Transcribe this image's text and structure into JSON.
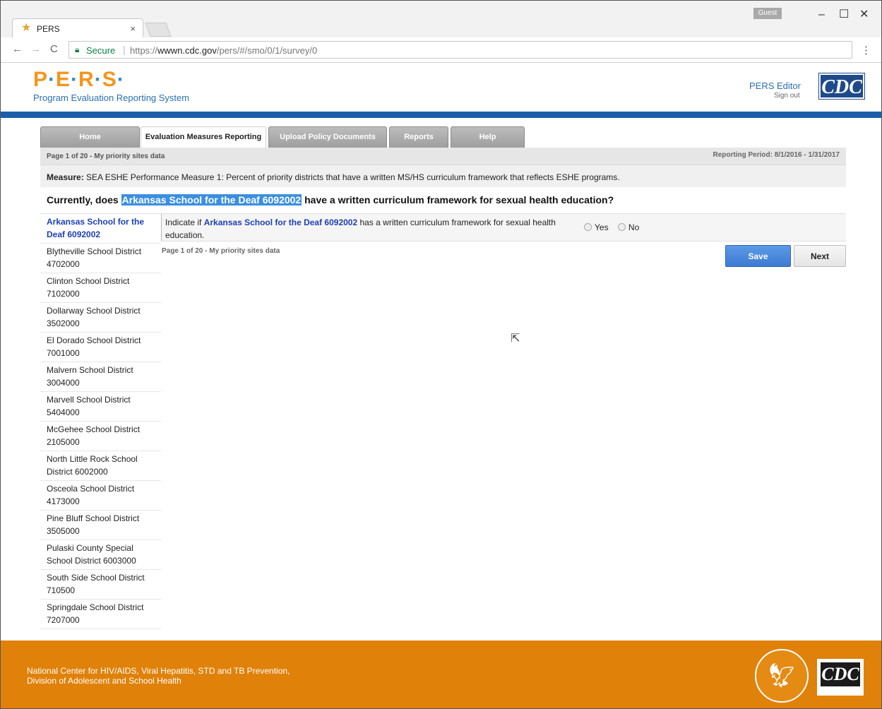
{
  "browser": {
    "tab_title": "PERS",
    "tab_close": "×",
    "guest_label": "Guest",
    "minimize": "–",
    "maximize": "☐",
    "close": "✕",
    "back": "←",
    "forward": "→",
    "reload": "C",
    "secure_label": "Secure",
    "url_scheme": "https://",
    "url_host": "wwwn.cdc.gov",
    "url_path": "/pers/#/smo/0/1/survey/0",
    "menu": "⋮"
  },
  "header": {
    "logo_p": "P",
    "logo_e": "E",
    "logo_r": "R",
    "logo_s": "S",
    "logo_dot": "·",
    "subtitle": "Program Evaluation Reporting System",
    "editor_label": "PERS Editor",
    "signout_label": "Sign out",
    "cdc_label": "CDC"
  },
  "nav": {
    "tabs": [
      {
        "label": "Home"
      },
      {
        "label": "Evaluation Measures Reporting"
      },
      {
        "label": "Upload Policy Documents"
      },
      {
        "label": "Reports"
      },
      {
        "label": "Help"
      }
    ]
  },
  "page": {
    "page_info": "Page 1 of 20 - My priority sites data",
    "reporting_period": "Reporting Period: 8/1/2016 - 1/31/2017",
    "measure_label": "Measure:",
    "measure_text": " SEA ESHE Performance Measure 1: Percent of priority districts that have a written MS/HS curriculum framework that reflects ESHE programs.",
    "question_prefix": "Currently, does ",
    "question_site": "Arkansas School for the Deaf 6092002",
    "question_suffix": " have a written curriculum framework for sexual health education?",
    "prompt_prefix": "Indicate if ",
    "prompt_site": "Arkansas School for the Deaf 6092002",
    "prompt_suffix": " has a written curriculum framework for sexual health education.",
    "yes_label": "Yes",
    "no_label": "No",
    "save_label": "Save",
    "next_label": "Next"
  },
  "sites": [
    {
      "name": "Arkansas School for the Deaf 6092002",
      "active": true
    },
    {
      "name": "Blytheville School District 4702000"
    },
    {
      "name": "Clinton School District 7102000"
    },
    {
      "name": "Dollarway School District 3502000"
    },
    {
      "name": "El Dorado School District 7001000"
    },
    {
      "name": "Malvern School District 3004000"
    },
    {
      "name": "Marvell School District 5404000"
    },
    {
      "name": "McGehee School District 2105000"
    },
    {
      "name": "North Little Rock School District 6002000"
    },
    {
      "name": "Osceola School District 4173000"
    },
    {
      "name": "Pine Bluff School District 3505000"
    },
    {
      "name": "Pulaski County Special School District 6003000"
    },
    {
      "name": "South Side School District 710500"
    },
    {
      "name": "Springdale School District 7207000"
    }
  ],
  "footer": {
    "line1": "National Center for HIV/AIDS, Viral Hepatitis, STD and TB Prevention,",
    "line2": "Division of Adolescent and School Health",
    "cdc_label": "CDC"
  },
  "colors": {
    "accent_orange": "#e0810a",
    "brand_blue": "#1b5fa8",
    "link_blue": "#1c3fb5",
    "highlight": "#3b8fe0"
  }
}
